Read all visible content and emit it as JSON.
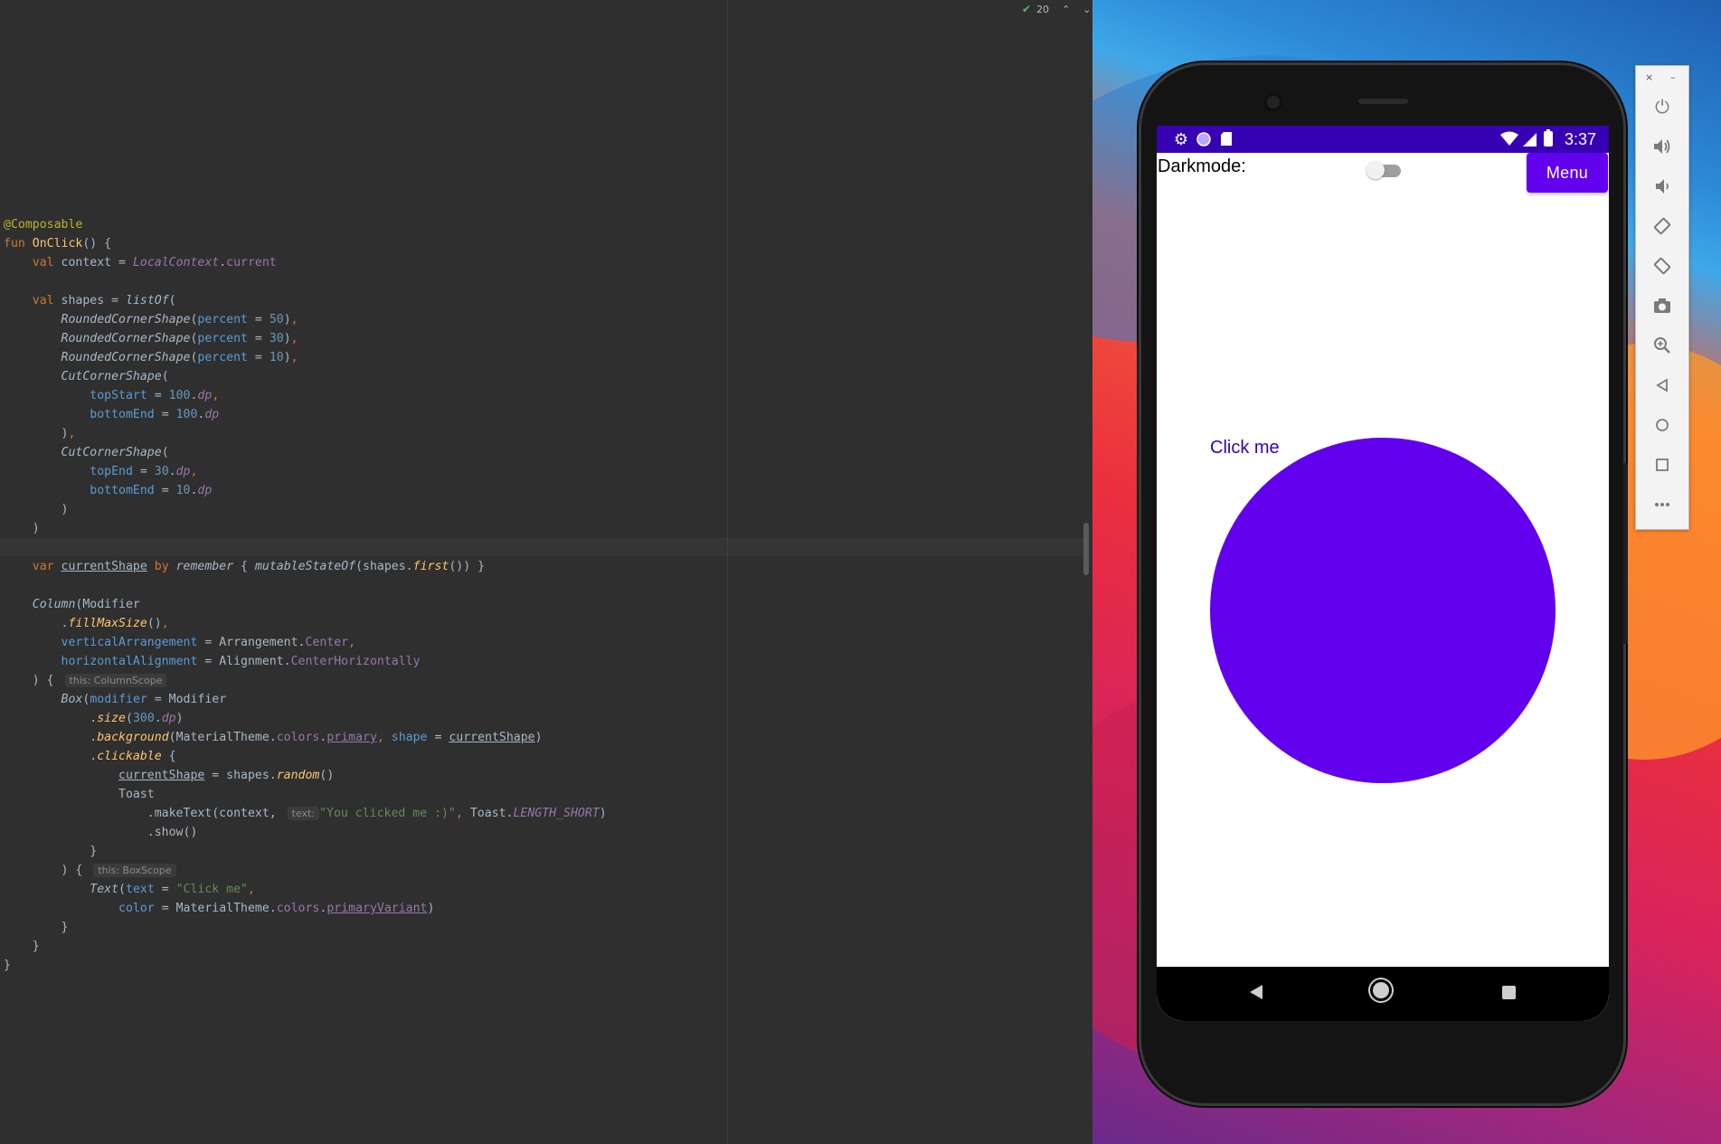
{
  "editor": {
    "inspection_count": "20",
    "code_lines": [
      [
        [
          "@Composable",
          "ann"
        ]
      ],
      [
        [
          "fun ",
          "kw"
        ],
        [
          "OnClick",
          "fn"
        ],
        [
          "() {",
          ""
        ]
      ],
      [
        [
          "    ",
          ""
        ],
        [
          "val ",
          "kw"
        ],
        [
          "context = ",
          ""
        ],
        [
          "LocalContext",
          "prop it"
        ],
        [
          ".",
          ""
        ],
        [
          "current",
          "prop"
        ]
      ],
      [
        [
          "",
          ""
        ]
      ],
      [
        [
          "    ",
          ""
        ],
        [
          "val ",
          "kw"
        ],
        [
          "shapes = ",
          ""
        ],
        [
          "listOf",
          "it"
        ],
        [
          "(",
          ""
        ]
      ],
      [
        [
          "        ",
          ""
        ],
        [
          "RoundedCornerShape",
          "it"
        ],
        [
          "(",
          ""
        ],
        [
          "percent",
          "par"
        ],
        [
          " = ",
          ""
        ],
        [
          "50",
          "num"
        ],
        [
          ")",
          ""
        ],
        [
          ",",
          "kw"
        ]
      ],
      [
        [
          "        ",
          ""
        ],
        [
          "RoundedCornerShape",
          "it"
        ],
        [
          "(",
          ""
        ],
        [
          "percent",
          "par"
        ],
        [
          " = ",
          ""
        ],
        [
          "30",
          "num"
        ],
        [
          ")",
          ""
        ],
        [
          ",",
          "kw"
        ]
      ],
      [
        [
          "        ",
          ""
        ],
        [
          "RoundedCornerShape",
          "it"
        ],
        [
          "(",
          ""
        ],
        [
          "percent",
          "par"
        ],
        [
          " = ",
          ""
        ],
        [
          "10",
          "num"
        ],
        [
          ")",
          ""
        ],
        [
          ",",
          "kw"
        ]
      ],
      [
        [
          "        ",
          ""
        ],
        [
          "CutCornerShape",
          "it"
        ],
        [
          "(",
          ""
        ]
      ],
      [
        [
          "            ",
          ""
        ],
        [
          "topStart",
          "par"
        ],
        [
          " = ",
          ""
        ],
        [
          "100",
          "num"
        ],
        [
          ".",
          ""
        ],
        [
          "dp",
          "prop it"
        ],
        [
          ",",
          "kw"
        ]
      ],
      [
        [
          "            ",
          ""
        ],
        [
          "bottomEnd",
          "par"
        ],
        [
          " = ",
          ""
        ],
        [
          "100",
          "num"
        ],
        [
          ".",
          ""
        ],
        [
          "dp",
          "prop it"
        ]
      ],
      [
        [
          "        ",
          ""
        ],
        [
          ")",
          ""
        ],
        [
          ",",
          "kw"
        ]
      ],
      [
        [
          "        ",
          ""
        ],
        [
          "CutCornerShape",
          "it"
        ],
        [
          "(",
          ""
        ]
      ],
      [
        [
          "            ",
          ""
        ],
        [
          "topEnd",
          "par"
        ],
        [
          " = ",
          ""
        ],
        [
          "30",
          "num"
        ],
        [
          ".",
          ""
        ],
        [
          "dp",
          "prop it"
        ],
        [
          ",",
          "kw"
        ]
      ],
      [
        [
          "            ",
          ""
        ],
        [
          "bottomEnd",
          "par"
        ],
        [
          " = ",
          ""
        ],
        [
          "10",
          "num"
        ],
        [
          ".",
          ""
        ],
        [
          "dp",
          "prop it"
        ]
      ],
      [
        [
          "        ",
          ""
        ],
        [
          ")",
          ""
        ]
      ],
      [
        [
          "    ",
          ""
        ],
        [
          ")",
          ""
        ]
      ],
      [
        [
          "",
          ""
        ]
      ],
      [
        [
          "    ",
          ""
        ],
        [
          "var ",
          "kw"
        ],
        [
          "currentShape",
          "ul"
        ],
        [
          " by ",
          "kw"
        ],
        [
          "remember",
          "it"
        ],
        [
          " { ",
          ""
        ],
        [
          "mutableStateOf",
          "it"
        ],
        [
          "(shapes.",
          ""
        ],
        [
          "first",
          "fn it"
        ],
        [
          "()) }",
          ""
        ]
      ],
      [
        [
          "",
          ""
        ]
      ],
      [
        [
          "    ",
          ""
        ],
        [
          "Column",
          "it"
        ],
        [
          "(Modifier",
          ""
        ]
      ],
      [
        [
          "        ",
          ""
        ],
        [
          ".",
          ""
        ],
        [
          "fillMaxSize",
          "fn it"
        ],
        [
          "()",
          ""
        ],
        [
          ",",
          "kw"
        ]
      ],
      [
        [
          "        ",
          ""
        ],
        [
          "verticalArrangement",
          "par"
        ],
        [
          " = Arrangement.",
          ""
        ],
        [
          "Center",
          "prop"
        ],
        [
          ",",
          "kw"
        ]
      ],
      [
        [
          "        ",
          ""
        ],
        [
          "horizontalAlignment",
          "par"
        ],
        [
          " = Alignment.",
          ""
        ],
        [
          "CenterHorizontally",
          "prop"
        ]
      ],
      [
        [
          "    ) { ",
          ""
        ],
        [
          "this: ColumnScope",
          "hint"
        ]
      ],
      [
        [
          "        ",
          ""
        ],
        [
          "Box",
          "it"
        ],
        [
          "(",
          ""
        ],
        [
          "modifier",
          "par"
        ],
        [
          " = Modifier",
          ""
        ]
      ],
      [
        [
          "            ",
          ""
        ],
        [
          ".",
          ""
        ],
        [
          "size",
          "fn it"
        ],
        [
          "(",
          ""
        ],
        [
          "300",
          "num"
        ],
        [
          ".",
          ""
        ],
        [
          "dp",
          "prop it"
        ],
        [
          ")",
          ""
        ]
      ],
      [
        [
          "            ",
          ""
        ],
        [
          ".",
          ""
        ],
        [
          "background",
          "fn it"
        ],
        [
          "(MaterialTheme.",
          ""
        ],
        [
          "colors",
          "prop"
        ],
        [
          ".",
          ""
        ],
        [
          "primary",
          "prop ul"
        ],
        [
          ", ",
          "kw"
        ],
        [
          "shape",
          "par"
        ],
        [
          " = ",
          ""
        ],
        [
          "currentShape",
          "ul"
        ],
        [
          ")",
          ""
        ]
      ],
      [
        [
          "            ",
          ""
        ],
        [
          ".",
          ""
        ],
        [
          "clickable",
          "fn it"
        ],
        [
          " {",
          ""
        ]
      ],
      [
        [
          "                ",
          ""
        ],
        [
          "currentShape",
          "ul"
        ],
        [
          " = shapes.",
          ""
        ],
        [
          "random",
          "fn it"
        ],
        [
          "()",
          ""
        ]
      ],
      [
        [
          "                Toast",
          ""
        ]
      ],
      [
        [
          "                    .makeText(context, ",
          ""
        ],
        [
          "text:",
          "hint"
        ],
        [
          "\"You clicked me :)\"",
          "str"
        ],
        [
          ", ",
          "kw"
        ],
        [
          "Toast.",
          ""
        ],
        [
          "LENGTH_SHORT",
          "prop it"
        ],
        [
          ")",
          ""
        ]
      ],
      [
        [
          "                    .show()",
          ""
        ]
      ],
      [
        [
          "            }",
          ""
        ]
      ],
      [
        [
          "        ) { ",
          ""
        ],
        [
          "this: BoxScope",
          "hint"
        ]
      ],
      [
        [
          "            ",
          ""
        ],
        [
          "Text",
          "it"
        ],
        [
          "(",
          ""
        ],
        [
          "text",
          "par"
        ],
        [
          " = ",
          ""
        ],
        [
          "\"Click me\"",
          "str"
        ],
        [
          ",",
          "kw"
        ]
      ],
      [
        [
          "                ",
          ""
        ],
        [
          "color",
          "par"
        ],
        [
          " = MaterialTheme.",
          ""
        ],
        [
          "colors",
          "prop"
        ],
        [
          ".",
          ""
        ],
        [
          "primaryVariant",
          "prop ul"
        ],
        [
          ")",
          ""
        ]
      ],
      [
        [
          "        }",
          ""
        ]
      ],
      [
        [
          "    }",
          ""
        ]
      ],
      [
        [
          "}",
          ""
        ]
      ]
    ]
  },
  "phone": {
    "status_bar": {
      "time": "3:37",
      "icons": [
        "settings-icon",
        "circle-notification-icon",
        "sd-card-icon",
        "wifi-icon",
        "cell-signal-icon",
        "battery-icon"
      ]
    },
    "app": {
      "darkmode_label": "Darkmode:",
      "darkmode_on": false,
      "menu_label": "Menu",
      "click_text": "Click me",
      "colors": {
        "primary": "#6200ee",
        "primary_variant": "#3700b3"
      }
    },
    "nav": [
      "back-icon",
      "home-icon",
      "recents-icon"
    ]
  },
  "emulator_toolbar": {
    "window_close": "×",
    "window_minimize": "–",
    "buttons": [
      "power-icon",
      "volume-up-icon",
      "volume-down-icon",
      "rotate-left-icon",
      "rotate-right-icon",
      "camera-icon",
      "zoom-icon",
      "back-icon",
      "home-icon",
      "overview-icon",
      "more-icon"
    ]
  }
}
